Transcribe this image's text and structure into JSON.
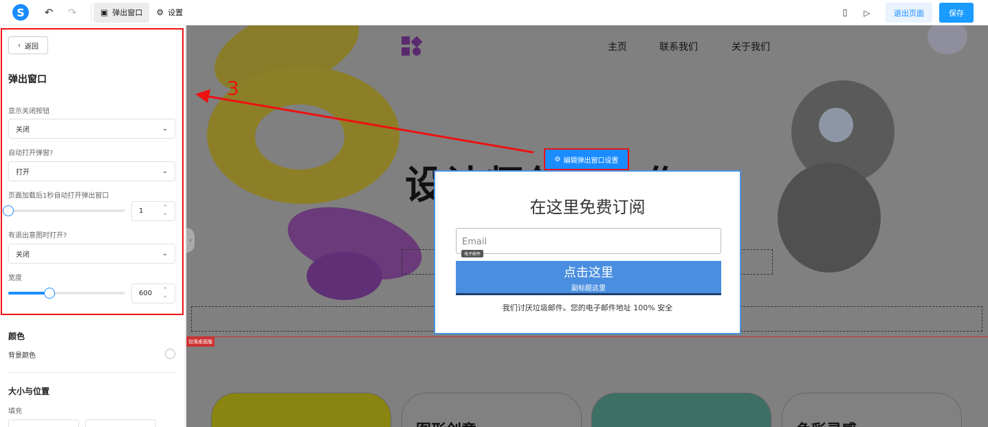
{
  "toolbar": {
    "logo_letter": "S",
    "tab_popup": "弹出窗口",
    "tab_settings": "设置",
    "exit_label": "退出页面",
    "save_label": "保存"
  },
  "sidebar": {
    "back_label": "返回",
    "panel_title": "弹出窗口",
    "show_close_label": "显示关闭按钮",
    "show_close_value": "关闭",
    "auto_open_label": "自动打开弹窗?",
    "auto_open_value": "打开",
    "delay_label": "页面加载后1秒自动打开弹出窗口",
    "delay_value": "1",
    "delay_fraction": 0.0,
    "exit_intent_label": "有退出意图时打开?",
    "exit_intent_value": "关闭",
    "width_label": "宽度",
    "width_value": "600",
    "width_fraction": 0.35,
    "color_title": "颜色",
    "bg_color_label": "背景颜色",
    "size_title": "大小与位置",
    "fill_label": "填充"
  },
  "canvas": {
    "nav": [
      "主页",
      "联系我们",
      "关于我们"
    ],
    "hero_title": "设计师创意之作。",
    "edit_tag": "编辑弹出窗口设置",
    "desktop_tag": "仅限桌面版",
    "card2_text": "图形创意",
    "card4_text": "色彩灵感",
    "colors": {
      "card1": "#8a8410",
      "card2": "#818181",
      "card3": "#3e6f65",
      "card4": "#818181"
    }
  },
  "popup": {
    "title": "在这里免费订阅",
    "email_placeholder": "Email",
    "email_tag": "电子邮件",
    "cta_main": "点击这里",
    "cta_sub": "副标题这里",
    "note": "我们讨厌垃圾邮件。您的电子邮件地址 100% 安全"
  },
  "annotation": {
    "step": "3"
  }
}
